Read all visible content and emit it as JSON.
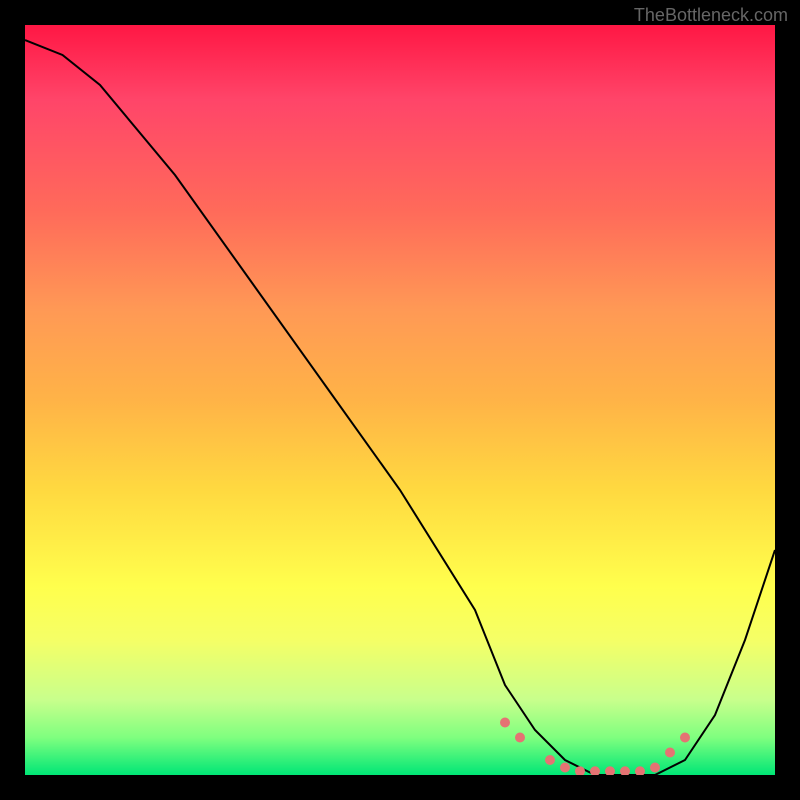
{
  "watermark": "TheBottleneck.com",
  "chart_data": {
    "type": "line",
    "title": "",
    "xlabel": "",
    "ylabel": "",
    "xlim": [
      0,
      100
    ],
    "ylim": [
      0,
      100
    ],
    "series": [
      {
        "name": "bottleneck-curve",
        "x": [
          0,
          5,
          10,
          20,
          30,
          40,
          50,
          60,
          64,
          68,
          72,
          76,
          80,
          84,
          88,
          92,
          96,
          100
        ],
        "y": [
          98,
          96,
          92,
          80,
          66,
          52,
          38,
          22,
          12,
          6,
          2,
          0,
          0,
          0,
          2,
          8,
          18,
          30
        ]
      }
    ],
    "highlight_points": {
      "name": "minimum-region-dots",
      "x": [
        64,
        66,
        70,
        72,
        74,
        76,
        78,
        80,
        82,
        84,
        86,
        88
      ],
      "y": [
        7,
        5,
        2,
        1,
        0.5,
        0.5,
        0.5,
        0.5,
        0.5,
        1,
        3,
        5
      ]
    },
    "gradient_colors": {
      "top": "#ff1744",
      "upper_mid": "#ff9955",
      "mid": "#ffff4d",
      "lower_mid": "#c8ff8c",
      "bottom": "#00e676"
    }
  }
}
